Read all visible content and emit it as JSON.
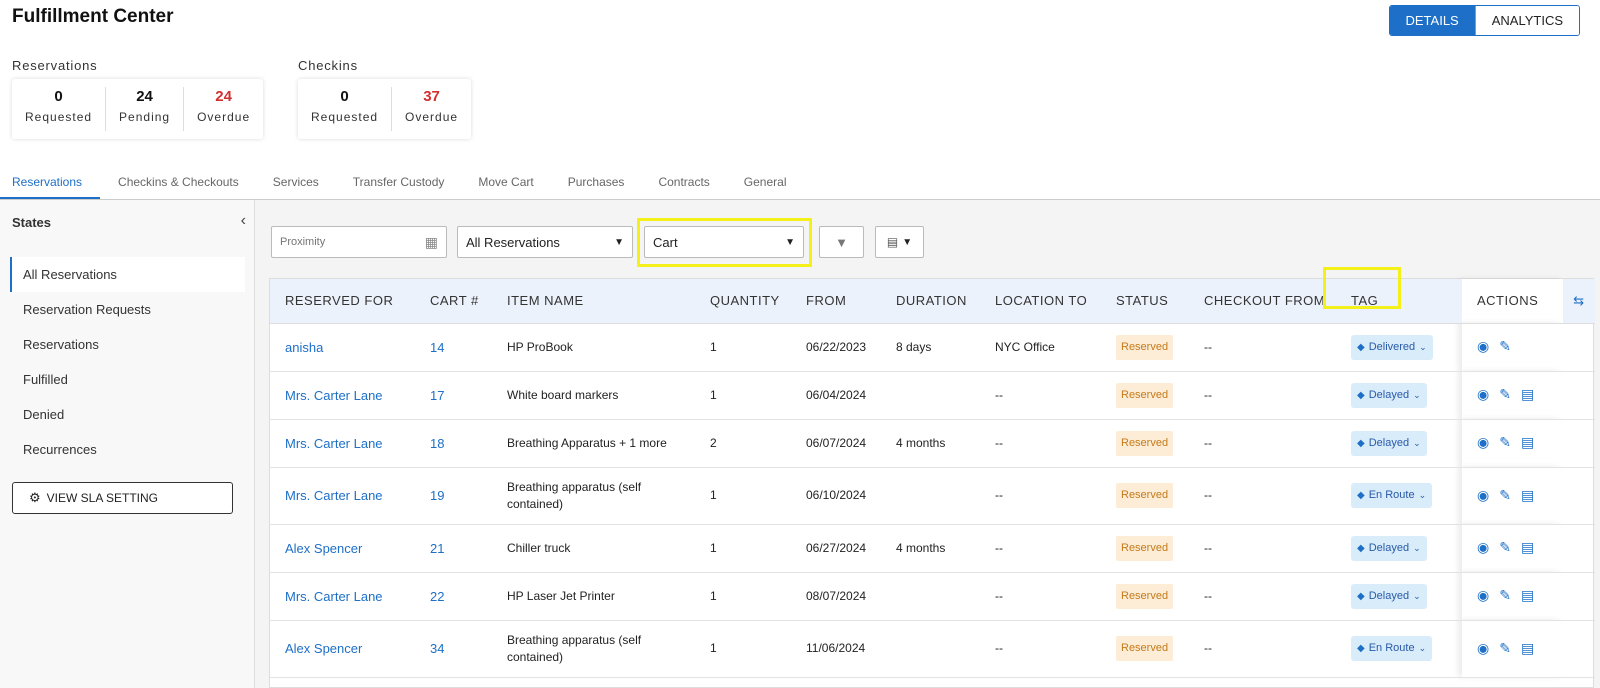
{
  "app": {
    "title": "Fulfillment Center"
  },
  "view_toggle": {
    "details": "DETAILS",
    "analytics": "ANALYTICS"
  },
  "stats": {
    "reservations": {
      "title": "Reservations",
      "cells": [
        {
          "value": "0",
          "label": "Requested"
        },
        {
          "value": "24",
          "label": "Pending"
        },
        {
          "value": "24",
          "label": "Overdue"
        }
      ]
    },
    "checkins": {
      "title": "Checkins",
      "cells": [
        {
          "value": "0",
          "label": "Requested"
        },
        {
          "value": "37",
          "label": "Overdue"
        }
      ]
    }
  },
  "tabs": [
    "Reservations",
    "Checkins & Checkouts",
    "Services",
    "Transfer Custody",
    "Move Cart",
    "Purchases",
    "Contracts",
    "General"
  ],
  "sidebar": {
    "title": "States",
    "items": [
      "All Reservations",
      "Reservation Requests",
      "Reservations",
      "Fulfilled",
      "Denied",
      "Recurrences"
    ],
    "sla_button": "VIEW SLA SETTING"
  },
  "filters": {
    "proximity_placeholder": "Proximity",
    "reservations_select": "All Reservations",
    "cart_select": "Cart"
  },
  "table": {
    "headers": [
      "RESERVED FOR",
      "CART #",
      "ITEM NAME",
      "QUANTITY",
      "FROM",
      "DURATION",
      "LOCATION TO",
      "STATUS",
      "CHECKOUT FROM",
      "TAG",
      "ACTIONS"
    ],
    "rows": [
      {
        "reserved_for": "anisha",
        "cart": "14",
        "item": "HP ProBook",
        "qty": "1",
        "from": "06/22/2023",
        "duration": "8 days",
        "location": "NYC Office",
        "status": "Reserved",
        "checkout": "--",
        "tag": "Delivered",
        "comment": false
      },
      {
        "reserved_for": "Mrs. Carter Lane",
        "cart": "17",
        "item": "White board markers",
        "qty": "1",
        "from": "06/04/2024",
        "duration": "",
        "location": "--",
        "status": "Reserved",
        "checkout": "--",
        "tag": "Delayed",
        "comment": true
      },
      {
        "reserved_for": "Mrs. Carter Lane",
        "cart": "18",
        "item": "Breathing Apparatus + 1 more",
        "qty": "2",
        "from": "06/07/2024",
        "duration": "4 months",
        "location": "--",
        "status": "Reserved",
        "checkout": "--",
        "tag": "Delayed",
        "comment": true
      },
      {
        "reserved_for": "Mrs. Carter Lane",
        "cart": "19",
        "item": "Breathing apparatus (self contained)",
        "qty": "1",
        "from": "06/10/2024",
        "duration": "",
        "location": "--",
        "status": "Reserved",
        "checkout": "--",
        "tag": "En Route",
        "comment": true
      },
      {
        "reserved_for": "Alex Spencer",
        "cart": "21",
        "item": "Chiller truck",
        "qty": "1",
        "from": "06/27/2024",
        "duration": "4 months",
        "location": "--",
        "status": "Reserved",
        "checkout": "--",
        "tag": "Delayed",
        "comment": true
      },
      {
        "reserved_for": "Mrs. Carter Lane",
        "cart": "22",
        "item": "HP Laser Jet Printer",
        "qty": "1",
        "from": "08/07/2024",
        "duration": "",
        "location": "--",
        "status": "Reserved",
        "checkout": "--",
        "tag": "Delayed",
        "comment": true
      },
      {
        "reserved_for": "Alex Spencer",
        "cart": "34",
        "item": "Breathing apparatus (self contained)",
        "qty": "1",
        "from": "11/06/2024",
        "duration": "",
        "location": "--",
        "status": "Reserved",
        "checkout": "--",
        "tag": "En Route",
        "comment": true
      }
    ]
  },
  "colors": {
    "accent": "#1d6fc7",
    "overdue": "#d32f2f",
    "highlight": "#f4f01a",
    "badge_bg": "#fdecd6",
    "tag_bg": "#d8ecfa"
  },
  "icons": {
    "calendar": "calendar-icon",
    "filter": "filter-icon",
    "comment_view": "comment-view-icon",
    "gear": "gear-icon",
    "tag": "tag-icon",
    "eye": "eye-icon",
    "edit": "pencil-icon",
    "comment": "comment-icon",
    "column_settings": "column-settings-icon"
  }
}
